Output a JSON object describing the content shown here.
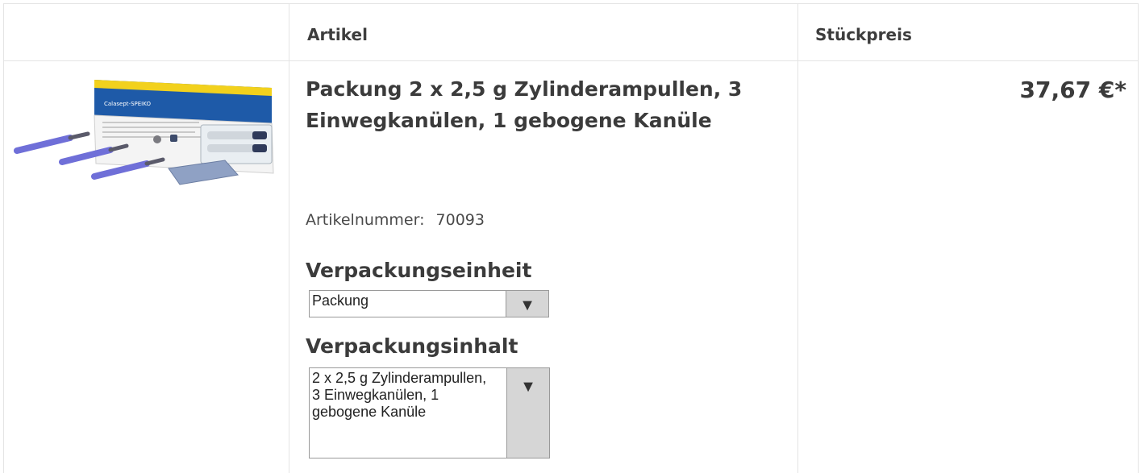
{
  "header": {
    "col_article": "Artikel",
    "col_price": "Stückpreis"
  },
  "product": {
    "title": "Packung 2 x 2,5 g Zylinderampullen, 3 Einwegkanülen, 1 gebogene Kanüle",
    "article_number_label": "Artikelnummer:",
    "article_number": "70093",
    "unit_label": "Verpackungseinheit",
    "unit_value": "Packung",
    "content_label": "Verpackungsinhalt",
    "content_value": "2 x 2,5 g Zylinderampullen, 3 Einwegkanülen, 1 gebogene Kanüle",
    "price": "37,67 €*",
    "image_icon": "product-photo"
  },
  "icons": {
    "dropdown": "▼"
  }
}
